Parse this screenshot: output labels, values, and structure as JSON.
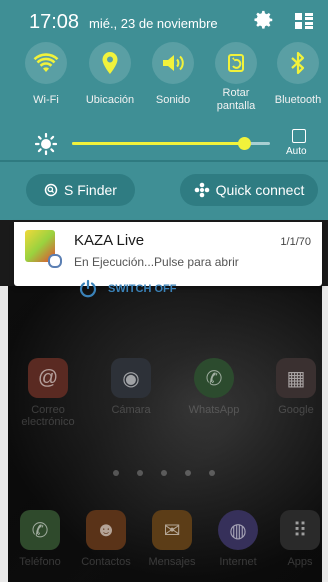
{
  "status": {
    "time": "17:08",
    "date": "mié., 23 de noviembre"
  },
  "quick_toggles": [
    {
      "label": "Wi-Fi",
      "icon": "wifi-icon",
      "active": true
    },
    {
      "label": "Ubicación",
      "icon": "location-pin-icon",
      "active": true
    },
    {
      "label": "Sonido",
      "icon": "speaker-icon",
      "active": true
    },
    {
      "label": "Rotar pantalla",
      "icon": "rotate-screen-icon",
      "active": true
    },
    {
      "label": "Bluetooth",
      "icon": "bluetooth-icon",
      "active": true
    }
  ],
  "brightness": {
    "level": 0.87,
    "auto_label": "Auto",
    "auto_checked": false
  },
  "buttons": {
    "s_finder": "S Finder",
    "quick_connect": "Quick connect"
  },
  "notification": {
    "app_name": "KAZA Live",
    "time": "1/1/70",
    "text": "En Ejecución...Pulse para abrir",
    "action": "SWITCH OFF"
  },
  "home_apps": [
    {
      "label": "Correo electrónico",
      "icon": "email-icon"
    },
    {
      "label": "Cámara",
      "icon": "camera-icon"
    },
    {
      "label": "WhatsApp",
      "icon": "whatsapp-icon"
    },
    {
      "label": "Google",
      "icon": "google-folder-icon"
    }
  ],
  "dock_apps": [
    {
      "label": "Teléfono",
      "icon": "phone-icon"
    },
    {
      "label": "Contactos",
      "icon": "contacts-icon"
    },
    {
      "label": "Mensajes",
      "icon": "messages-icon"
    },
    {
      "label": "Internet",
      "icon": "internet-icon"
    },
    {
      "label": "Apps",
      "icon": "apps-grid-icon"
    }
  ],
  "colors": {
    "panel": "#3f8f95",
    "toggle_active": "#f1f23b",
    "action_blue": "#3a82b8"
  }
}
